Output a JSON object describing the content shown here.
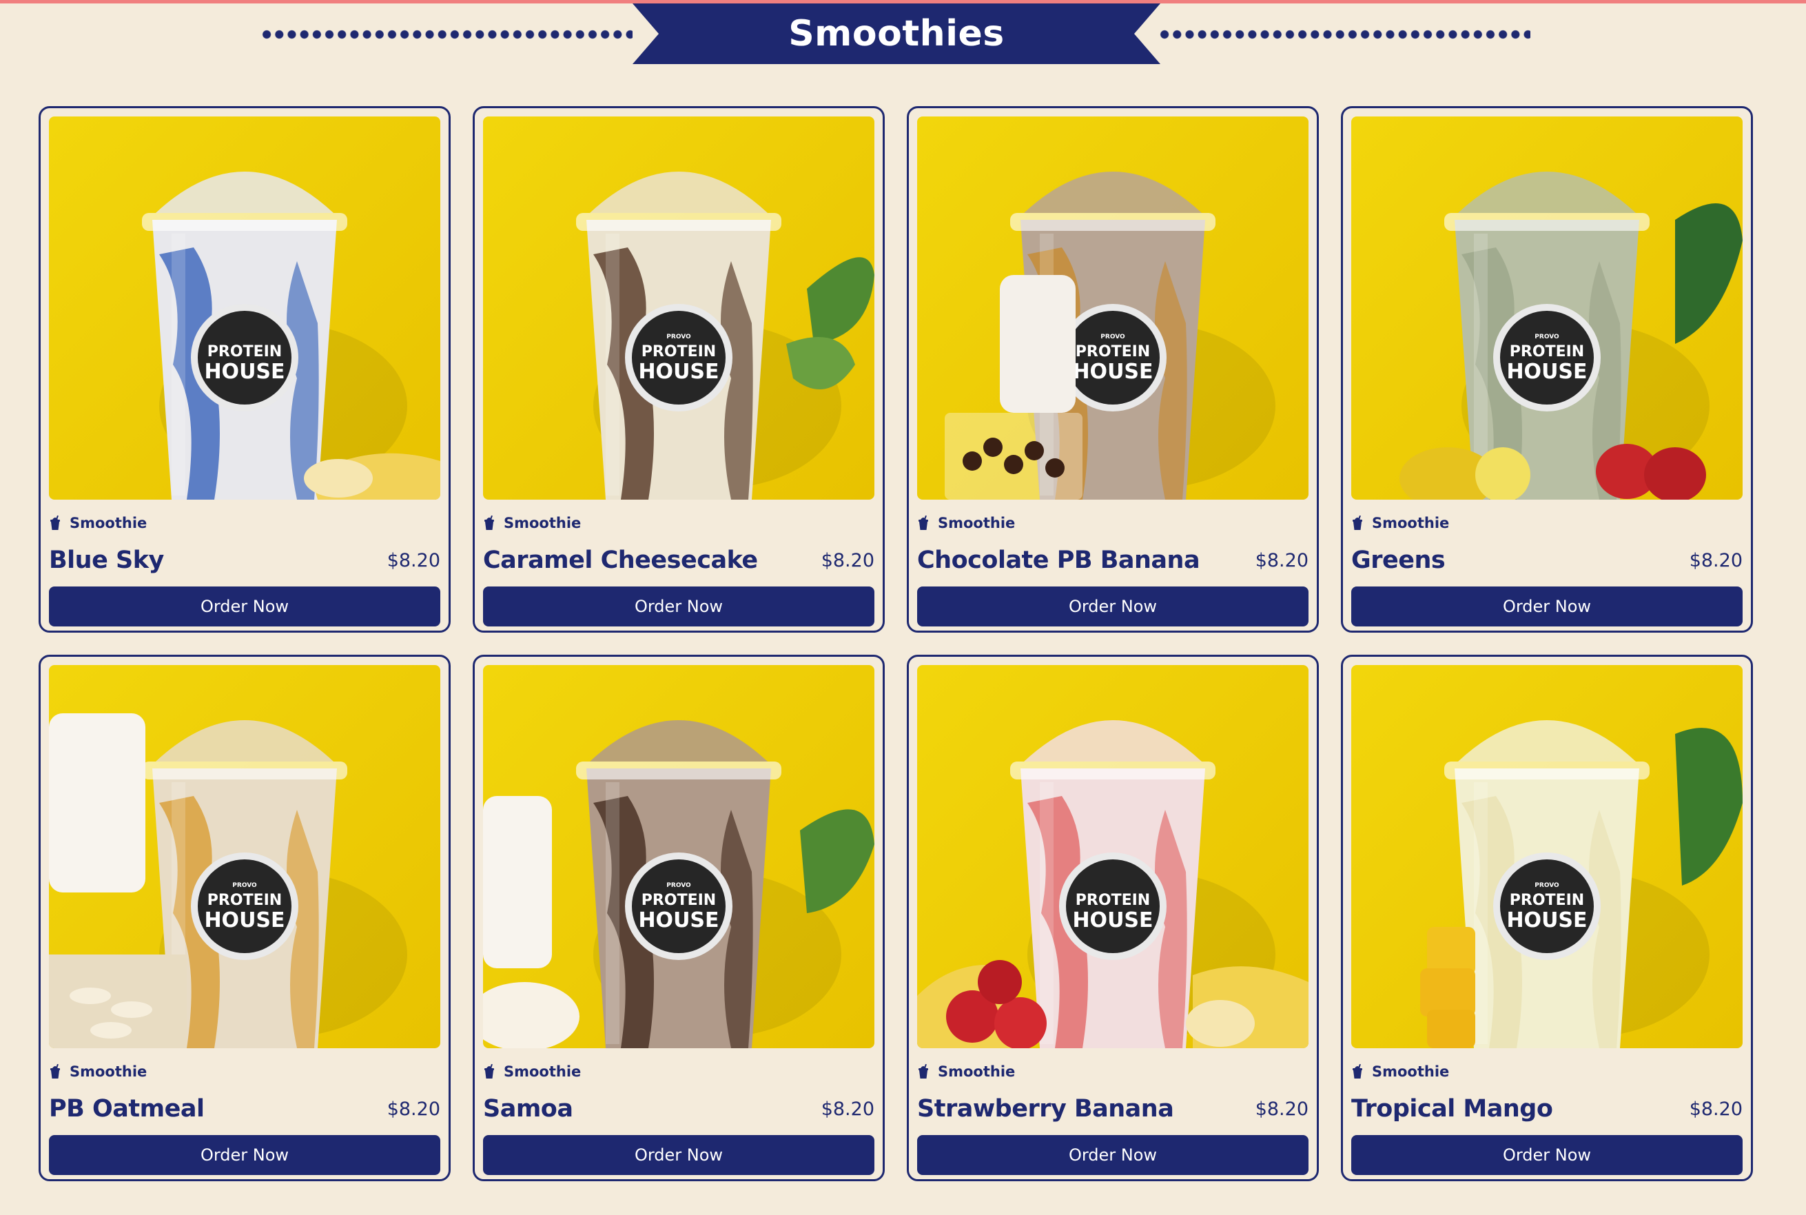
{
  "header": {
    "title": "Smoothies"
  },
  "items": [
    {
      "name": "Blue Sky",
      "price": "$8.20",
      "tag": "Smoothie",
      "cta": "Order Now",
      "photo": {
        "bg": "#f2d60c",
        "bg2": "#e8c200",
        "drink": "#e8e8ec",
        "swirl": "#2d5bb8",
        "logo_top": "",
        "logo_text": "PROTEIN HOUSE",
        "prop": "banana"
      }
    },
    {
      "name": "Caramel Cheesecake",
      "price": "$8.20",
      "tag": "Smoothie",
      "cta": "Order Now",
      "photo": {
        "bg": "#ecc9b0",
        "bg2": "#e2b89c",
        "drink": "#ebe3cf",
        "swirl": "#4a2a18",
        "logo_top": "PROVO",
        "logo_text": "PROTEIN HOUSE",
        "prop": "leaf"
      }
    },
    {
      "name": "Chocolate PB Banana",
      "price": "$8.20",
      "tag": "Smoothie",
      "cta": "Order Now",
      "photo": {
        "bg": "#efcaaa",
        "bg2": "#e8bd9a",
        "drink": "#b8a594",
        "swirl": "#c8892a",
        "logo_top": "PROVO",
        "logo_text": "PROTEIN HOUSE",
        "prop": "chips"
      }
    },
    {
      "name": "Greens",
      "price": "$8.20",
      "tag": "Smoothie",
      "cta": "Order Now",
      "photo": {
        "bg": "#8fd4a8",
        "bg2": "#6cc08c",
        "drink": "#b8bfa4",
        "swirl": "#9aa488",
        "logo_top": "PROVO",
        "logo_text": "PROTEIN HOUSE",
        "prop": "fruit"
      }
    },
    {
      "name": "PB Oatmeal",
      "price": "$8.20",
      "tag": "Smoothie",
      "cta": "Order Now",
      "photo": {
        "bg": "#efd4b8",
        "bg2": "#e6c6a4",
        "drink": "#e8dcc6",
        "swirl": "#d89a2a",
        "logo_top": "PROVO",
        "logo_text": "PROTEIN HOUSE",
        "prop": "oats"
      }
    },
    {
      "name": "Samoa",
      "price": "$8.20",
      "tag": "Smoothie",
      "cta": "Order Now",
      "photo": {
        "bg": "#efcfb4",
        "bg2": "#e6c09f",
        "drink": "#b09a8a",
        "swirl": "#3e2418",
        "logo_top": "PROVO",
        "logo_text": "PROTEIN HOUSE",
        "prop": "coconut"
      }
    },
    {
      "name": "Strawberry Banana",
      "price": "$8.20",
      "tag": "Smoothie",
      "cta": "Order Now",
      "photo": {
        "bg": "#f0bcbc",
        "bg2": "#e8a8a8",
        "drink": "#f2dede",
        "swirl": "#e06060",
        "logo_top": "",
        "logo_text": "PROTEIN HOUSE",
        "prop": "berries"
      }
    },
    {
      "name": "Tropical Mango",
      "price": "$8.20",
      "tag": "Smoothie",
      "cta": "Order Now",
      "photo": {
        "bg": "#f4df1c",
        "bg2": "#eacc00",
        "drink": "#f2efcf",
        "swirl": "#e8e0b0",
        "logo_top": "PROVO",
        "logo_text": "PROTEIN HOUSE",
        "prop": "mango"
      }
    }
  ]
}
